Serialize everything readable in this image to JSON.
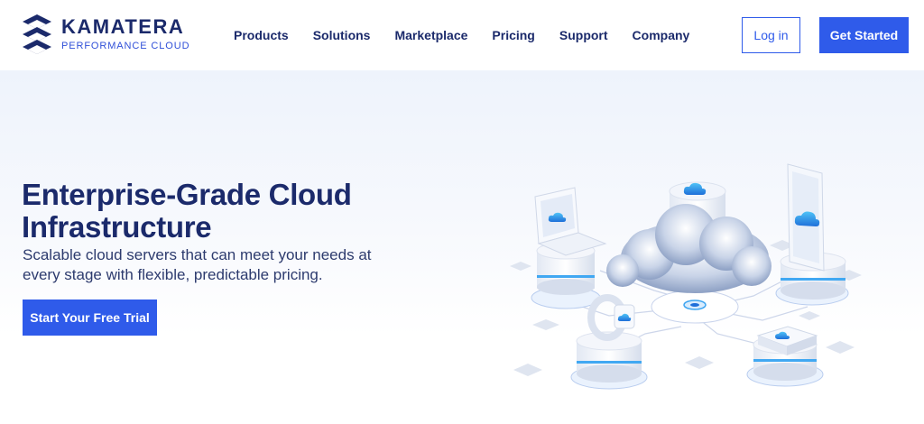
{
  "brand": {
    "name": "KAMATERA",
    "tagline": "PERFORMANCE CLOUD",
    "primary_color": "#2f5bea",
    "text_color": "#1b2a6b"
  },
  "nav": {
    "items": [
      "Products",
      "Solutions",
      "Marketplace",
      "Pricing",
      "Support",
      "Company"
    ]
  },
  "header_actions": {
    "login_label": "Log in",
    "get_started_label": "Get Started"
  },
  "hero": {
    "title": "Enterprise-Grade Cloud Infrastructure",
    "subtitle": "Scalable cloud servers that can meet your needs at every stage with flexible, predictable pricing.",
    "cta_label": "Start Your Free Trial"
  },
  "illustration": {
    "icons": [
      "cloud-icon",
      "laptop-icon",
      "tablet-icon",
      "watch-icon",
      "server-icon"
    ]
  }
}
